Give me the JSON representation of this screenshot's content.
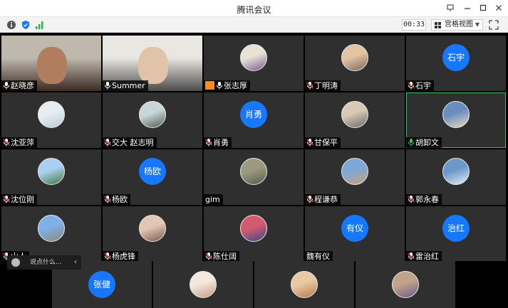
{
  "window": {
    "title": "腾讯会议"
  },
  "toolbar": {
    "timer": "00:33",
    "view_mode": "宫格视图"
  },
  "participants": [
    {
      "name": "赵晓彦",
      "mic": "on",
      "kind": "video",
      "colors": [
        "#bfb9ad",
        "#3a2a22"
      ]
    },
    {
      "name": "Summer",
      "mic": "on",
      "kind": "video",
      "colors": [
        "#e9e7e2",
        "#4b4b4b"
      ]
    },
    {
      "name": "张志厚",
      "mic": "on",
      "kind": "photo",
      "host": true,
      "colors": [
        "#e8e2d5",
        "#7a5b92"
      ]
    },
    {
      "name": "丁明涛",
      "mic": "off",
      "kind": "photo",
      "colors": [
        "#e2c3a2",
        "#7a6b5a"
      ]
    },
    {
      "name": "石宇",
      "mic": "off",
      "kind": "text",
      "avatar_text": "石宇"
    },
    {
      "name": "沈亚萍",
      "mic": "off",
      "kind": "photo",
      "colors": [
        "#e7eef3",
        "#b8c9d8"
      ]
    },
    {
      "name": "交大 赵志明",
      "mic": "off",
      "kind": "photo",
      "colors": [
        "#c9d6d8",
        "#4d5f54"
      ]
    },
    {
      "name": "肖勇",
      "mic": "off",
      "kind": "text",
      "avatar_text": "肖勇"
    },
    {
      "name": "甘保平",
      "mic": "off",
      "kind": "photo",
      "colors": [
        "#d8c8b5",
        "#6b6b6b"
      ]
    },
    {
      "name": "胡卸文",
      "mic": "active",
      "kind": "photo",
      "highlight": true,
      "colors": [
        "#6a8fbf",
        "#e8d9c2"
      ]
    },
    {
      "name": "沈位刚",
      "mic": "off",
      "kind": "photo",
      "colors": [
        "#a9d0f0",
        "#3d7a3a"
      ]
    },
    {
      "name": "杨欧",
      "mic": "off",
      "kind": "text",
      "avatar_text": "杨欧"
    },
    {
      "name": "gim",
      "mic": "none",
      "kind": "photo",
      "colors": [
        "#9c9a7e",
        "#5a5a4a"
      ]
    },
    {
      "name": "程谦恭",
      "mic": "off",
      "kind": "photo",
      "colors": [
        "#7da8d6",
        "#c9a27a"
      ]
    },
    {
      "name": "郭永春",
      "mic": "off",
      "kind": "photo",
      "colors": [
        "#6c98c8",
        "#e5eef6"
      ]
    },
    {
      "name": "山人",
      "mic": "off",
      "kind": "photo",
      "colors": [
        "#7fb0e8",
        "#8a8a7a"
      ]
    },
    {
      "name": "杨虎锋",
      "mic": "off",
      "kind": "photo",
      "colors": [
        "#e2c7b4",
        "#7b5a48"
      ]
    },
    {
      "name": "陈仕阔",
      "mic": "off",
      "kind": "photo",
      "colors": [
        "#d65a6f",
        "#3a4a8a"
      ]
    },
    {
      "name": "魏有仪",
      "mic": "none",
      "kind": "text",
      "avatar_text": "有仪"
    },
    {
      "name": "雷治红",
      "mic": "off",
      "kind": "text",
      "avatar_text": "治红"
    }
  ],
  "bottom_participants": [
    {
      "kind": "text",
      "avatar_text": "张健"
    },
    {
      "kind": "photo",
      "colors": [
        "#f2e8de",
        "#c99a82"
      ]
    },
    {
      "kind": "photo",
      "colors": [
        "#e8c9a2",
        "#b9794a"
      ]
    },
    {
      "kind": "photo",
      "colors": [
        "#bfa48a",
        "#6f5a8a"
      ]
    }
  ],
  "chat": {
    "placeholder": "说点什么..."
  },
  "colors": {
    "avatar_blue": "#1677ff",
    "active_speaker": "#3cc06a",
    "tile_bg": "#2f2f2f"
  }
}
